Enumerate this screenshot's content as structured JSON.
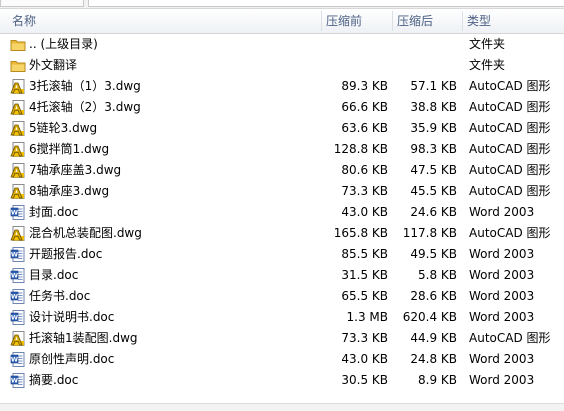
{
  "columns": {
    "name": "名称",
    "compressed_size": "压缩前",
    "packed_size": "压缩后",
    "type": "类型"
  },
  "files": [
    {
      "name": ".. (上级目录)",
      "size": "",
      "packed": "",
      "type": "文件夹",
      "icon": "folder-icon"
    },
    {
      "name": "外文翻译",
      "size": "",
      "packed": "",
      "type": "文件夹",
      "icon": "folder-icon"
    },
    {
      "name": "3托滚轴（1）3.dwg",
      "size": "89.3 KB",
      "packed": "57.1 KB",
      "type": "AutoCAD 图形",
      "icon": "autocad-file-icon"
    },
    {
      "name": "4托滚轴（2）3.dwg",
      "size": "66.6 KB",
      "packed": "38.8 KB",
      "type": "AutoCAD 图形",
      "icon": "autocad-file-icon"
    },
    {
      "name": "5链轮3.dwg",
      "size": "63.6 KB",
      "packed": "35.9 KB",
      "type": "AutoCAD 图形",
      "icon": "autocad-file-icon"
    },
    {
      "name": "6搅拌筒1.dwg",
      "size": "128.8 KB",
      "packed": "98.3 KB",
      "type": "AutoCAD 图形",
      "icon": "autocad-file-icon"
    },
    {
      "name": "7轴承座盖3.dwg",
      "size": "80.6 KB",
      "packed": "47.5 KB",
      "type": "AutoCAD 图形",
      "icon": "autocad-file-icon"
    },
    {
      "name": "8轴承座3.dwg",
      "size": "73.3 KB",
      "packed": "45.5 KB",
      "type": "AutoCAD 图形",
      "icon": "autocad-file-icon"
    },
    {
      "name": "封面.doc",
      "size": "43.0 KB",
      "packed": "24.6 KB",
      "type": "Word 2003",
      "icon": "word-file-icon"
    },
    {
      "name": "混合机总装配图.dwg",
      "size": "165.8 KB",
      "packed": "117.8 KB",
      "type": "AutoCAD 图形",
      "icon": "autocad-file-icon"
    },
    {
      "name": "开题报告.doc",
      "size": "85.5 KB",
      "packed": "49.5 KB",
      "type": "Word 2003",
      "icon": "word-file-icon"
    },
    {
      "name": "目录.doc",
      "size": "31.5 KB",
      "packed": "5.8 KB",
      "type": "Word 2003",
      "icon": "word-file-icon"
    },
    {
      "name": "任务书.doc",
      "size": "65.5 KB",
      "packed": "28.6 KB",
      "type": "Word 2003",
      "icon": "word-file-icon"
    },
    {
      "name": "设计说明书.doc",
      "size": "1.3 MB",
      "packed": "620.4 KB",
      "type": "Word 2003",
      "icon": "word-file-icon"
    },
    {
      "name": "托滚轴1装配图.dwg",
      "size": "73.3 KB",
      "packed": "44.9 KB",
      "type": "AutoCAD 图形",
      "icon": "autocad-file-icon"
    },
    {
      "name": "原创性声明.doc",
      "size": "43.0 KB",
      "packed": "24.8 KB",
      "type": "Word 2003",
      "icon": "word-file-icon"
    },
    {
      "name": "摘要.doc",
      "size": "30.5 KB",
      "packed": "8.9 KB",
      "type": "Word 2003",
      "icon": "word-file-icon"
    }
  ]
}
